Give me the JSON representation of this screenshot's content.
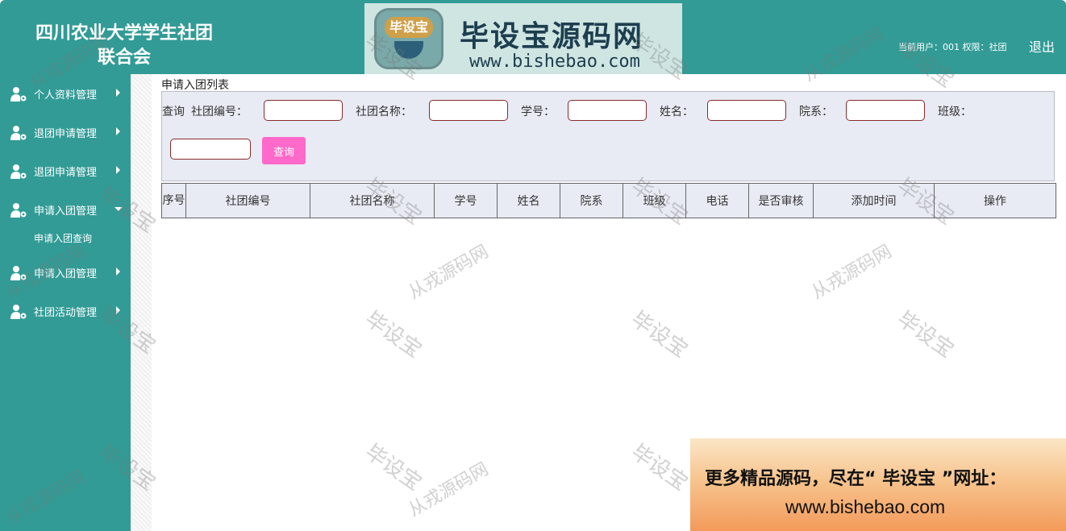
{
  "header": {
    "title_line1": "四川农业大学学生社团",
    "title_line2": "联合会",
    "banner_badge": "毕设宝",
    "banner_title": "毕设宝源码网",
    "banner_url": "www.bishebao.com",
    "user_info": "当前用户：001 权限：社团",
    "logout_label": "退出"
  },
  "sidebar": {
    "items": [
      {
        "label": "个人资料管理",
        "icon": "user-gear-icon"
      },
      {
        "label": "退团申请管理",
        "icon": "user-gear-icon"
      },
      {
        "label": "退团申请管理",
        "icon": "user-gear-icon"
      },
      {
        "label": "申请入团管理",
        "icon": "user-gear-icon",
        "expanded": true
      },
      {
        "label": "申请入团管理",
        "icon": "user-gear-icon"
      },
      {
        "label": "社团活动管理",
        "icon": "user-gear-icon"
      }
    ],
    "submenu": [
      "申请入团查询"
    ]
  },
  "main": {
    "heading": "申请入团列表",
    "search": {
      "query_label": "查询",
      "fields": [
        {
          "label": "社团编号：",
          "value": ""
        },
        {
          "label": "社团名称：",
          "value": ""
        },
        {
          "label": "学号：",
          "value": ""
        },
        {
          "label": "姓名：",
          "value": ""
        },
        {
          "label": "院系：",
          "value": ""
        },
        {
          "label": "班级：",
          "value": ""
        }
      ],
      "button_label": "查询"
    },
    "table": {
      "columns": [
        "序号",
        "社团编号",
        "社团名称",
        "学号",
        "姓名",
        "院系",
        "班级",
        "电话",
        "是否审核",
        "添加时间",
        "操作"
      ],
      "rows": []
    }
  },
  "watermarks": {
    "a": "毕设宝",
    "b": "从戎源码网"
  },
  "promo": {
    "line1": "更多精品源码，尽在“ 毕设宝 ”网址：",
    "line2": "www.bishebao.com"
  },
  "colors": {
    "primary": "#329b96",
    "button": "#ff69c9",
    "panel": "#e8ebf4"
  }
}
